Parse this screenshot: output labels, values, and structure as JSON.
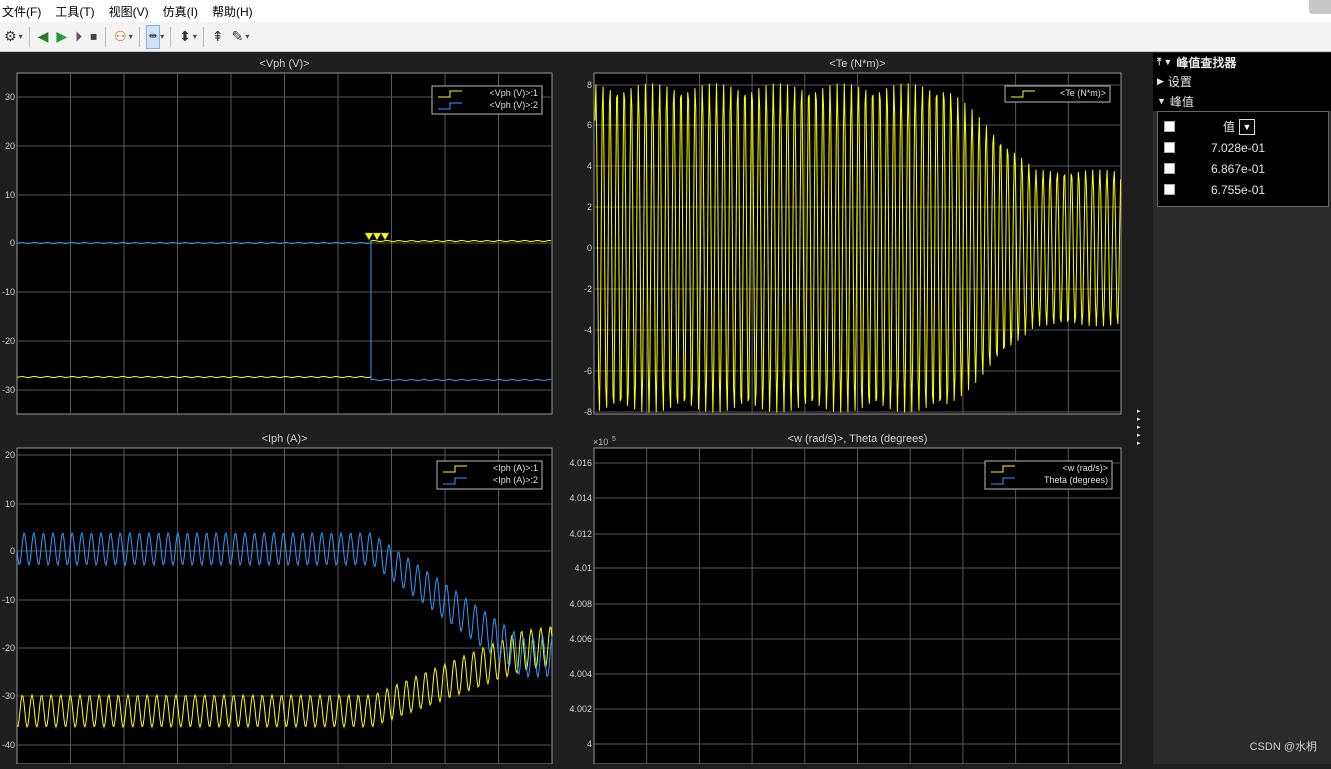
{
  "menu": [
    "文件(F)",
    "工具(T)",
    "视图(V)",
    "仿真(I)",
    "帮助(H)"
  ],
  "plots": {
    "vph": {
      "title": "<Vph (V)>",
      "yticks": [
        "30",
        "20",
        "10",
        "0",
        "-10",
        "-20",
        "-30"
      ],
      "legend": [
        "<Vph (V)>:1",
        "<Vph (V)>:2"
      ]
    },
    "te": {
      "title": "<Te (N*m)>",
      "yticks": [
        "8",
        "6",
        "4",
        "2",
        "0",
        "-2",
        "-4",
        "-6",
        "-8"
      ],
      "legend": [
        "<Te (N*m)>"
      ]
    },
    "iph": {
      "title": "<Iph (A)>",
      "yticks": [
        "20",
        "10",
        "0",
        "-10",
        "-20",
        "-30",
        "-40"
      ],
      "legend": [
        "<Iph (A)>:1",
        "<Iph (A)>:2"
      ]
    },
    "w": {
      "title": "<w (rad/s)>, Theta (degrees)",
      "exponent": "×10",
      "exponent_power": "5",
      "yticks": [
        "4.016",
        "4.014",
        "4.012",
        "4.01",
        "4.008",
        "4.006",
        "4.004",
        "4.002",
        "4"
      ],
      "legend": [
        "<w (rad/s)>",
        "Theta (degrees)"
      ]
    }
  },
  "peak_finder": {
    "title": "峰值查找器",
    "settings": "设置",
    "peaks": "峰值",
    "value_header": "值",
    "values": [
      "7.028e-01",
      "6.867e-01",
      "6.755e-01"
    ]
  },
  "watermark": "CSDN @水枂",
  "colors": {
    "ch1": "#ffff00",
    "ch2": "#3399ff",
    "grid": "#595959",
    "axes_bg": "#000000"
  }
}
